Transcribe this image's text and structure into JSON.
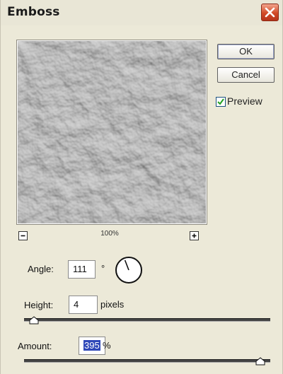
{
  "dialog": {
    "title": "Emboss"
  },
  "buttons": {
    "ok_label": "OK",
    "cancel_label": "Cancel",
    "close_icon": "close-icon"
  },
  "preview": {
    "checkbox_label": "Preview",
    "checked": true,
    "zoom_level": "100%"
  },
  "fields": {
    "angle_label": "Angle:",
    "angle_value": "111",
    "angle_unit": "°",
    "height_label": "Height:",
    "height_value": "4",
    "height_unit": "pixels",
    "amount_label": "Amount:",
    "amount_value": "395",
    "amount_unit": "%"
  },
  "sliders": {
    "height_fraction": 0.02,
    "amount_fraction": 0.98
  }
}
